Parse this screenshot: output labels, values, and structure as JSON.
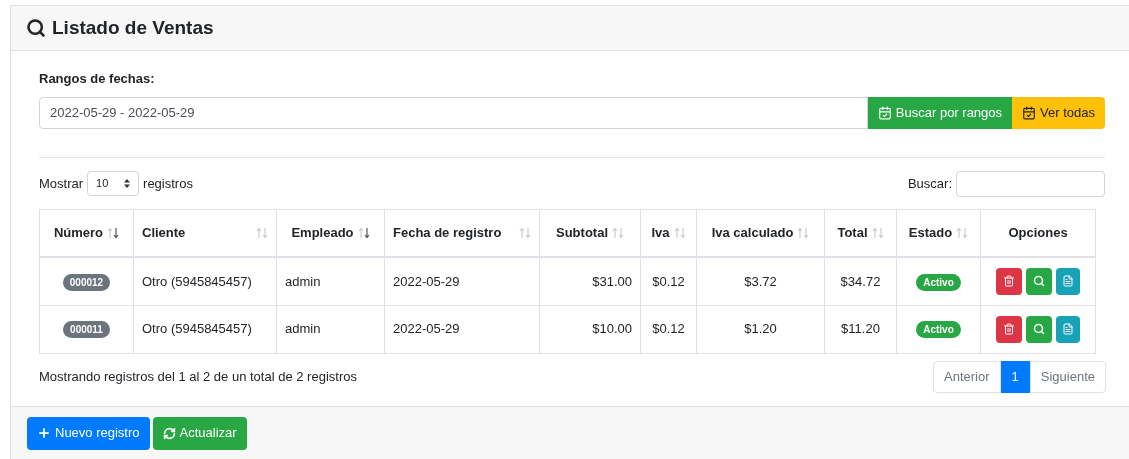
{
  "card": {
    "title": "Listado de Ventas"
  },
  "filter": {
    "label": "Rangos de fechas:",
    "value": "2022-05-29 - 2022-05-29",
    "buttons": [
      {
        "label": "Buscar por rangos",
        "kind": "search"
      },
      {
        "label": "Ver todas",
        "kind": "all"
      }
    ]
  },
  "length": {
    "prefix": "Mostrar",
    "value": "10",
    "suffix": "registros"
  },
  "search": {
    "label": "Buscar:"
  },
  "table": {
    "columns": [
      {
        "label": "Número",
        "sorted": true
      },
      {
        "label": "Cliente",
        "sorted": false
      },
      {
        "label": "Empleado",
        "sorted": true
      },
      {
        "label": "Fecha de registro",
        "sorted": false
      },
      {
        "label": "Subtotal",
        "sorted": false
      },
      {
        "label": "Iva",
        "sorted": false
      },
      {
        "label": "Iva calculado",
        "sorted": false
      },
      {
        "label": "Total",
        "sorted": false
      },
      {
        "label": "Estado",
        "sorted": false
      },
      {
        "label": "Opciones"
      }
    ],
    "rows": [
      {
        "numero": "000012",
        "cliente": "Otro (5945845457)",
        "empleado": "admin",
        "fecha": "2022-05-29",
        "subtotal": "$31.00",
        "iva": "$0.12",
        "iva_calculado": "$3.72",
        "total": "$34.72",
        "estado": "Activo"
      },
      {
        "numero": "000011",
        "cliente": "Otro (5945845457)",
        "empleado": "admin",
        "fecha": "2022-05-29",
        "subtotal": "$10.00",
        "iva": "$0.12",
        "iva_calculado": "$1.20",
        "total": "$11.20",
        "estado": "Activo"
      }
    ]
  },
  "info": "Mostrando registros del 1 al 2 de un total de 2 registros",
  "pagination": [
    {
      "label": "Anterior",
      "selected": false
    },
    {
      "label": "1",
      "selected": true
    },
    {
      "label": "Siguiente",
      "selected": false
    }
  ],
  "footer": {
    "buttons": [
      {
        "label": "Nuevo registro",
        "kind": "new"
      },
      {
        "label": "Actualizar",
        "kind": "refresh"
      }
    ]
  }
}
